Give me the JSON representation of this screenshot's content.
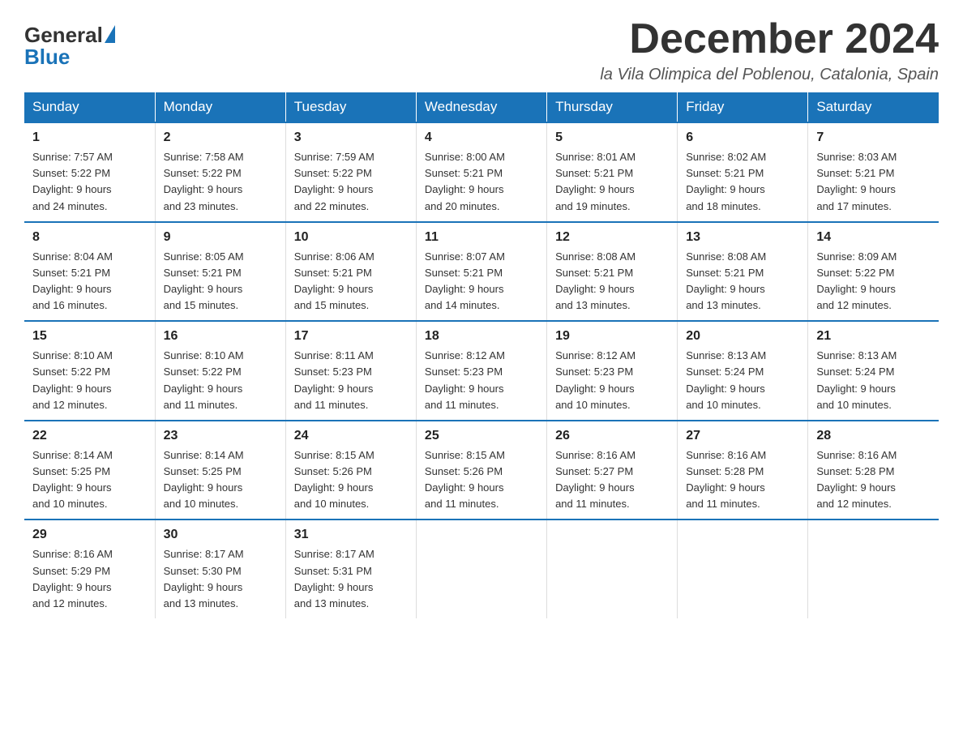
{
  "header": {
    "logo_general": "General",
    "logo_blue": "Blue",
    "title": "December 2024",
    "location": "la Vila Olimpica del Poblenou, Catalonia, Spain"
  },
  "days_of_week": [
    "Sunday",
    "Monday",
    "Tuesday",
    "Wednesday",
    "Thursday",
    "Friday",
    "Saturday"
  ],
  "weeks": [
    [
      {
        "day": "1",
        "sunrise": "7:57 AM",
        "sunset": "5:22 PM",
        "daylight": "9 hours and 24 minutes."
      },
      {
        "day": "2",
        "sunrise": "7:58 AM",
        "sunset": "5:22 PM",
        "daylight": "9 hours and 23 minutes."
      },
      {
        "day": "3",
        "sunrise": "7:59 AM",
        "sunset": "5:22 PM",
        "daylight": "9 hours and 22 minutes."
      },
      {
        "day": "4",
        "sunrise": "8:00 AM",
        "sunset": "5:21 PM",
        "daylight": "9 hours and 20 minutes."
      },
      {
        "day": "5",
        "sunrise": "8:01 AM",
        "sunset": "5:21 PM",
        "daylight": "9 hours and 19 minutes."
      },
      {
        "day": "6",
        "sunrise": "8:02 AM",
        "sunset": "5:21 PM",
        "daylight": "9 hours and 18 minutes."
      },
      {
        "day": "7",
        "sunrise": "8:03 AM",
        "sunset": "5:21 PM",
        "daylight": "9 hours and 17 minutes."
      }
    ],
    [
      {
        "day": "8",
        "sunrise": "8:04 AM",
        "sunset": "5:21 PM",
        "daylight": "9 hours and 16 minutes."
      },
      {
        "day": "9",
        "sunrise": "8:05 AM",
        "sunset": "5:21 PM",
        "daylight": "9 hours and 15 minutes."
      },
      {
        "day": "10",
        "sunrise": "8:06 AM",
        "sunset": "5:21 PM",
        "daylight": "9 hours and 15 minutes."
      },
      {
        "day": "11",
        "sunrise": "8:07 AM",
        "sunset": "5:21 PM",
        "daylight": "9 hours and 14 minutes."
      },
      {
        "day": "12",
        "sunrise": "8:08 AM",
        "sunset": "5:21 PM",
        "daylight": "9 hours and 13 minutes."
      },
      {
        "day": "13",
        "sunrise": "8:08 AM",
        "sunset": "5:21 PM",
        "daylight": "9 hours and 13 minutes."
      },
      {
        "day": "14",
        "sunrise": "8:09 AM",
        "sunset": "5:22 PM",
        "daylight": "9 hours and 12 minutes."
      }
    ],
    [
      {
        "day": "15",
        "sunrise": "8:10 AM",
        "sunset": "5:22 PM",
        "daylight": "9 hours and 12 minutes."
      },
      {
        "day": "16",
        "sunrise": "8:10 AM",
        "sunset": "5:22 PM",
        "daylight": "9 hours and 11 minutes."
      },
      {
        "day": "17",
        "sunrise": "8:11 AM",
        "sunset": "5:23 PM",
        "daylight": "9 hours and 11 minutes."
      },
      {
        "day": "18",
        "sunrise": "8:12 AM",
        "sunset": "5:23 PM",
        "daylight": "9 hours and 11 minutes."
      },
      {
        "day": "19",
        "sunrise": "8:12 AM",
        "sunset": "5:23 PM",
        "daylight": "9 hours and 10 minutes."
      },
      {
        "day": "20",
        "sunrise": "8:13 AM",
        "sunset": "5:24 PM",
        "daylight": "9 hours and 10 minutes."
      },
      {
        "day": "21",
        "sunrise": "8:13 AM",
        "sunset": "5:24 PM",
        "daylight": "9 hours and 10 minutes."
      }
    ],
    [
      {
        "day": "22",
        "sunrise": "8:14 AM",
        "sunset": "5:25 PM",
        "daylight": "9 hours and 10 minutes."
      },
      {
        "day": "23",
        "sunrise": "8:14 AM",
        "sunset": "5:25 PM",
        "daylight": "9 hours and 10 minutes."
      },
      {
        "day": "24",
        "sunrise": "8:15 AM",
        "sunset": "5:26 PM",
        "daylight": "9 hours and 10 minutes."
      },
      {
        "day": "25",
        "sunrise": "8:15 AM",
        "sunset": "5:26 PM",
        "daylight": "9 hours and 11 minutes."
      },
      {
        "day": "26",
        "sunrise": "8:16 AM",
        "sunset": "5:27 PM",
        "daylight": "9 hours and 11 minutes."
      },
      {
        "day": "27",
        "sunrise": "8:16 AM",
        "sunset": "5:28 PM",
        "daylight": "9 hours and 11 minutes."
      },
      {
        "day": "28",
        "sunrise": "8:16 AM",
        "sunset": "5:28 PM",
        "daylight": "9 hours and 12 minutes."
      }
    ],
    [
      {
        "day": "29",
        "sunrise": "8:16 AM",
        "sunset": "5:29 PM",
        "daylight": "9 hours and 12 minutes."
      },
      {
        "day": "30",
        "sunrise": "8:17 AM",
        "sunset": "5:30 PM",
        "daylight": "9 hours and 13 minutes."
      },
      {
        "day": "31",
        "sunrise": "8:17 AM",
        "sunset": "5:31 PM",
        "daylight": "9 hours and 13 minutes."
      },
      null,
      null,
      null,
      null
    ]
  ],
  "labels": {
    "sunrise": "Sunrise:",
    "sunset": "Sunset:",
    "daylight": "Daylight:"
  }
}
